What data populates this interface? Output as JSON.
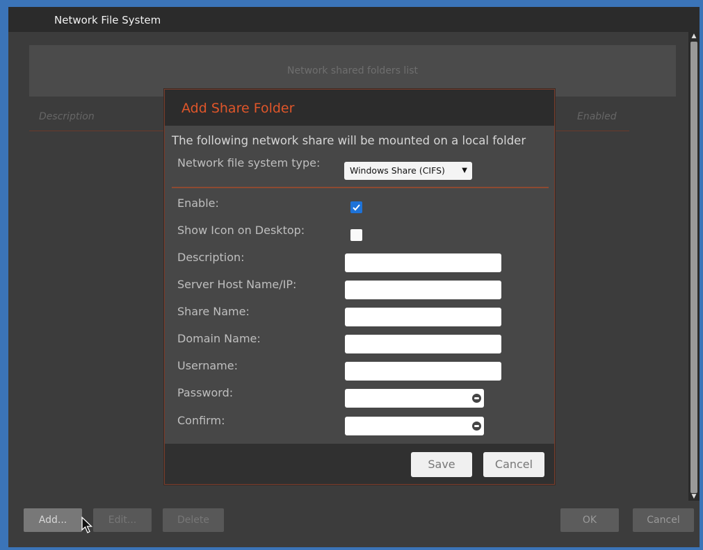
{
  "window": {
    "title": "Network File System"
  },
  "list": {
    "header": "Network shared folders list",
    "col_description": "Description",
    "col_enabled": "Enabled"
  },
  "bottom": {
    "add": "Add...",
    "edit": "Edit...",
    "delete": "Delete",
    "ok": "OK",
    "cancel": "Cancel"
  },
  "dialog": {
    "title": "Add Share Folder",
    "message": "The following network share will be mounted on a local folder",
    "type_label": "Network file system type:",
    "type_value": "Windows Share (CIFS)",
    "enable_label": "Enable:",
    "enable_checked": true,
    "show_icon_label": "Show Icon on Desktop:",
    "show_icon_checked": false,
    "description_label": "Description:",
    "host_label": "Server Host Name/IP:",
    "share_label": "Share Name:",
    "domain_label": "Domain Name:",
    "username_label": "Username:",
    "password_label": "Password:",
    "confirm_label": "Confirm:",
    "description_value": "",
    "host_value": "",
    "share_value": "",
    "domain_value": "",
    "username_value": "",
    "password_value": "",
    "confirm_value": "",
    "save": "Save",
    "cancel": "Cancel"
  },
  "icons": {
    "checkbox": "check-icon",
    "password_reveal": "eye-icon",
    "cursor": "mouse-pointer-icon",
    "scroll_up": "arrow-up-icon",
    "scroll_down": "arrow-down-icon"
  },
  "colors": {
    "accent": "#e0562a",
    "checkbox": "#1e73d8",
    "frame": "#3b74b8"
  }
}
